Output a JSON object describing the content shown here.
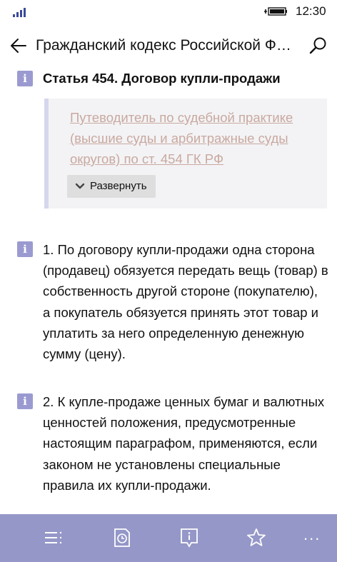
{
  "status": {
    "time": "12:30",
    "signal_icon": "signal-bars-icon",
    "battery_icon": "battery-charging-icon"
  },
  "header": {
    "title": "Гражданский кодекс Российской Федерации (часть вторая)",
    "back_icon": "back-arrow-icon",
    "search_icon": "search-icon"
  },
  "article": {
    "heading": "Статья 454. Договор купли-продажи",
    "guide_link": "Путеводитель по судебной практике (высшие суды и арбитражные суды округов) по ст. 454 ГК РФ",
    "expand_label": "Развернуть",
    "paragraphs": [
      "1. По договору купли-продажи одна сторона (продавец) обязуется передать вещь (товар) в собственность другой стороне (покупателю), а покупатель обязуется принять этот товар и уплатить за него определенную денежную сумму (цену).",
      "2. К купле-продаже ценных бумаг и валютных ценностей положения, предусмотренные настоящим параграфом, применяются, если законом не установлены специальные правила их купли-продажи."
    ]
  },
  "appbar": {
    "background": "#9597c8",
    "icons": [
      "contents-list-icon",
      "history-clock-icon",
      "info-icon",
      "bookmark-star-icon",
      "more-dots-icon"
    ],
    "more_label": "..."
  },
  "colors": {
    "info_badge": "#9b9ad0",
    "link": "#c9a9a0",
    "guide_border": "#d6d6ee"
  }
}
